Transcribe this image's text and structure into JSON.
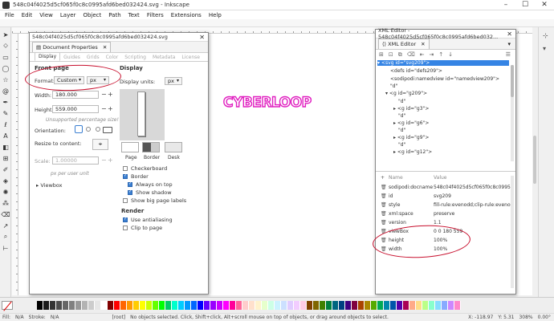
{
  "window": {
    "title": "548c04f4025d5cf065f0c8c0995afd6bed032424.svg - Inkscape",
    "controls": [
      "–",
      "☐",
      "✕"
    ]
  },
  "menu": [
    "File",
    "Edit",
    "View",
    "Layer",
    "Object",
    "Path",
    "Text",
    "Filters",
    "Extensions",
    "Help"
  ],
  "canvas": {
    "logo_text": "CYBERLOOP"
  },
  "doc_props": {
    "title": "548c04f4025d5cf065f0c8c0995afd6bed032424.svg",
    "tab_label": "Document Properties",
    "subtabs": [
      "Display",
      "Guides",
      "Grids",
      "Color",
      "Scripting",
      "Metadata",
      "License"
    ],
    "front_page": "Front page",
    "format_label": "Format:",
    "format_value": "Custom",
    "format_unit": "px",
    "width_label": "Width:",
    "width_value": "180.000",
    "height_label": "Height:",
    "height_value": "559.000",
    "unsupported": "Unsupported percentage size!",
    "orientation_label": "Orientation:",
    "resize_label": "Resize to content:",
    "scale_label": "Scale:",
    "scale_value": "1.00000",
    "scale_note": "px per user unit",
    "viewbox": "Viewbox",
    "display_section": "Display",
    "display_units_label": "Display units:",
    "display_units_value": "px",
    "swatch_labels": [
      "Page",
      "Border",
      "Desk"
    ],
    "checkboxes": [
      {
        "label": "Checkerboard",
        "on": false
      },
      {
        "label": "Border",
        "on": true
      },
      {
        "label": "Always on top",
        "on": true
      },
      {
        "label": "Show shadow",
        "on": true
      },
      {
        "label": "Show big page labels",
        "on": false
      }
    ],
    "render_section": "Render",
    "render_checkboxes": [
      {
        "label": "Use antialiasing",
        "on": true
      },
      {
        "label": "Clip to page",
        "on": false
      }
    ]
  },
  "xml_editor": {
    "title": "XML Editor - 548c04f4025d5cf065f0c8c0995afd6bed032...",
    "tab_label": "XML Editor",
    "nodes": [
      {
        "indent": 0,
        "text": "<svg id=\"svg209\">",
        "sel": true
      },
      {
        "indent": 1,
        "text": "<defs id=\"defs209\">"
      },
      {
        "indent": 1,
        "text": "<sodipodi:namedview id=\"namedview209\">"
      },
      {
        "indent": 1,
        "text": "\"d\""
      },
      {
        "indent": 1,
        "text": "<g id=\"g209\">"
      },
      {
        "indent": 2,
        "text": "\"d\""
      },
      {
        "indent": 2,
        "text": "<g id=\"g3\">"
      },
      {
        "indent": 2,
        "text": "\"d\""
      },
      {
        "indent": 2,
        "text": "<g id=\"g6\">"
      },
      {
        "indent": 2,
        "text": "\"d\""
      },
      {
        "indent": 2,
        "text": "<g id=\"g9\">"
      },
      {
        "indent": 2,
        "text": "\"d\""
      },
      {
        "indent": 2,
        "text": "<g id=\"g12\">"
      }
    ],
    "col_name": "Name",
    "col_value": "Value",
    "attributes": [
      {
        "name": "sodipodi:docname",
        "value": "548c04f4025d5cf065f0c8c0995afd6be..."
      },
      {
        "name": "id",
        "value": "svg209"
      },
      {
        "name": "style",
        "value": "fill-rule:evenodd;clip-rule:evenodd;s..."
      },
      {
        "name": "xml:space",
        "value": "preserve"
      },
      {
        "name": "version",
        "value": "1.1"
      },
      {
        "name": "viewBox",
        "value": "0 0 180 559"
      },
      {
        "name": "height",
        "value": "100%"
      },
      {
        "name": "width",
        "value": "100%"
      }
    ]
  },
  "status": {
    "fill_label": "Fill:",
    "fill_value": "N/A",
    "stroke_label": "Stroke:",
    "stroke_value": "N/A",
    "layer": "[root]",
    "message": "No objects selected. Click, Shift+click, Alt+scroll mouse on top of objects, or drag around objects to select.",
    "x": "X: -118.97",
    "y": "Y: 5.31",
    "zoom": "308%",
    "rotation": "0.00°"
  },
  "palette": [
    "#000000",
    "#1a1a1a",
    "#333333",
    "#4d4d4d",
    "#666666",
    "#808080",
    "#999999",
    "#b3b3b3",
    "#cccccc",
    "#e6e6e6",
    "#ffffff",
    "#800000",
    "#ff0000",
    "#ff6600",
    "#ff9900",
    "#ffcc00",
    "#ffff00",
    "#ccff00",
    "#66ff00",
    "#00ff00",
    "#00cc66",
    "#00ffcc",
    "#00ccff",
    "#0099ff",
    "#0066ff",
    "#0000ff",
    "#6600ff",
    "#9900ff",
    "#cc00ff",
    "#ff00ff",
    "#ff0099",
    "#ff6699",
    "#ffcccc",
    "#ffe0cc",
    "#fff2cc",
    "#e6ffcc",
    "#ccffe6",
    "#ccf2ff",
    "#cce0ff",
    "#e0ccff",
    "#f2ccff",
    "#ffcce6",
    "#804000",
    "#806600",
    "#408000",
    "#008040",
    "#006680",
    "#004080",
    "#400080",
    "#800040",
    "#aa4400",
    "#aa8800",
    "#55aa00",
    "#00aa55",
    "#0088aa",
    "#0055aa",
    "#5500aa",
    "#aa0055",
    "#ffaa88",
    "#ffdd88",
    "#bbff88",
    "#88ffcc",
    "#88ddff",
    "#88aaff",
    "#cc88ff",
    "#ff88cc"
  ]
}
